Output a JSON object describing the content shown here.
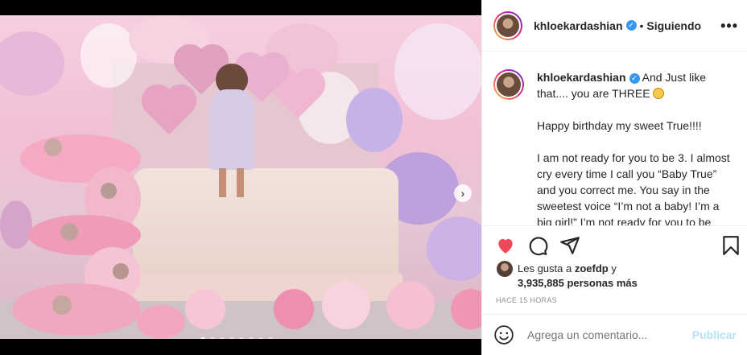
{
  "post": {
    "username": "khloekardashian",
    "follow_status": "Siguiendo",
    "more_label": "•••"
  },
  "caption": {
    "username": "khloekardashian",
    "line1": "And Just like that.... you are THREE",
    "line2": "Happy birthday my sweet True!!!!",
    "line3": "I am not ready for you to be 3. I almost cry every time I call you “Baby True” and you correct me. You say in the sweetest voice “I’m not a baby! I’m a big girl!” I’m not ready for you to be"
  },
  "likes": {
    "prefix": "Les gusta a",
    "liker": "zoefdp",
    "conjunction": "y",
    "count_text": "3,935,885 personas más"
  },
  "timestamp": "HACE 15 HORAS",
  "composer": {
    "placeholder": "Agrega un comentario...",
    "publish_label": "Publicar"
  },
  "carousel": {
    "slide_count": 8,
    "active_index": 0
  },
  "icons": {
    "like": "heart-icon",
    "comment": "comment-icon",
    "share": "share-icon",
    "save": "bookmark-icon",
    "emoji": "smiley-icon",
    "next": "chevron-right-icon"
  },
  "colors": {
    "like_red": "#ed4956",
    "verified_blue": "#3897f0",
    "publish_disabled": "#b2dffc"
  }
}
